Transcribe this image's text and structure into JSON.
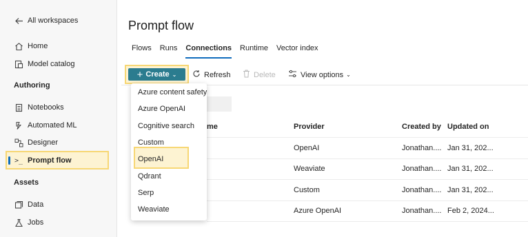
{
  "sidebar": {
    "back_label": "All workspaces",
    "items_top": [
      {
        "label": "Home",
        "icon": "home-icon"
      },
      {
        "label": "Model catalog",
        "icon": "catalog-icon"
      }
    ],
    "authoring_heading": "Authoring",
    "authoring_items": [
      {
        "label": "Notebooks",
        "icon": "notebook-icon"
      },
      {
        "label": "Automated ML",
        "icon": "automl-icon"
      },
      {
        "label": "Designer",
        "icon": "designer-icon"
      },
      {
        "label": "Prompt flow",
        "icon": "prompt-flow-icon"
      }
    ],
    "assets_heading": "Assets",
    "assets_items": [
      {
        "label": "Data",
        "icon": "data-icon"
      },
      {
        "label": "Jobs",
        "icon": "jobs-icon"
      }
    ]
  },
  "page": {
    "title": "Prompt flow",
    "tabs": [
      "Flows",
      "Runs",
      "Connections",
      "Runtime",
      "Vector index"
    ],
    "active_tab": "Connections"
  },
  "toolbar": {
    "create_label": "Create",
    "refresh_label": "Refresh",
    "delete_label": "Delete",
    "view_options_label": "View options"
  },
  "menu": {
    "items": [
      "Azure content safety",
      "Azure OpenAI",
      "Cognitive search",
      "Custom",
      "OpenAI",
      "Qdrant",
      "Serp",
      "Weaviate"
    ],
    "highlighted": "OpenAI"
  },
  "table": {
    "columns": {
      "name": "me",
      "provider": "Provider",
      "created_by": "Created by",
      "updated_on": "Updated on"
    },
    "rows": [
      {
        "provider": "OpenAI",
        "created_by": "Jonathan....",
        "updated_on": "Jan 31, 202..."
      },
      {
        "provider": "Weaviate",
        "created_by": "Jonathan....",
        "updated_on": "Jan 31, 202..."
      },
      {
        "provider": "Custom",
        "created_by": "Jonathan....",
        "updated_on": "Jan 31, 202..."
      },
      {
        "provider": "Azure OpenAI",
        "created_by": "Jonathan....",
        "updated_on": "Feb 2, 2024..."
      }
    ]
  },
  "colors": {
    "accent": "#0f6cbd",
    "create_button": "#2b7c8f",
    "highlight_border": "#f7d774",
    "highlight_fill": "#fdf3d2"
  }
}
